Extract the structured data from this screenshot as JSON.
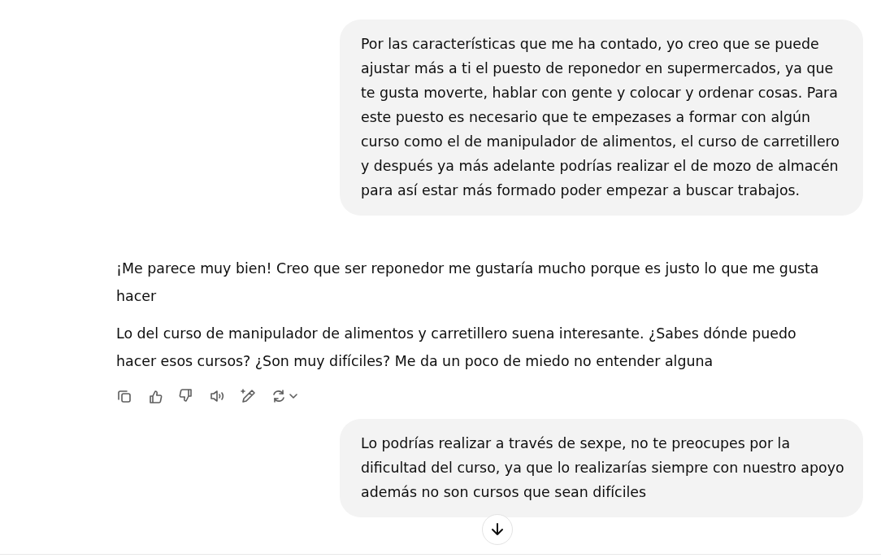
{
  "messages": [
    {
      "kind": "user",
      "paragraphs": [
        "Por las características que me ha contado, yo creo que se puede ajustar más a ti el puesto de reponedor en supermercados, ya que te gusta moverte, hablar con gente y colocar y ordenar cosas. Para este puesto es necesario que te empezases a formar con algún curso como el de manipulador de alimentos, el curso de carretillero y después ya más adelante podrías realizar el de mozo de almacén para así estar más formado poder empezar a buscar trabajos."
      ]
    },
    {
      "kind": "assistant",
      "paragraphs": [
        "¡Me parece muy bien! Creo que ser reponedor me gustaría mucho porque es justo lo que me gusta hacer",
        "Lo del curso de manipulador de alimentos y carretillero suena interesante. ¿Sabes dónde puedo hacer esos cursos? ¿Son muy difíciles? Me da un poco de miedo no entender alguna"
      ]
    },
    {
      "kind": "user",
      "paragraphs": [
        "Lo podrías realizar a través de sexpe, no te preocupes por la dificultad del curso, ya que lo realizarías siempre con nuestro apoyo además no son cursos que sean difíciles"
      ]
    }
  ]
}
